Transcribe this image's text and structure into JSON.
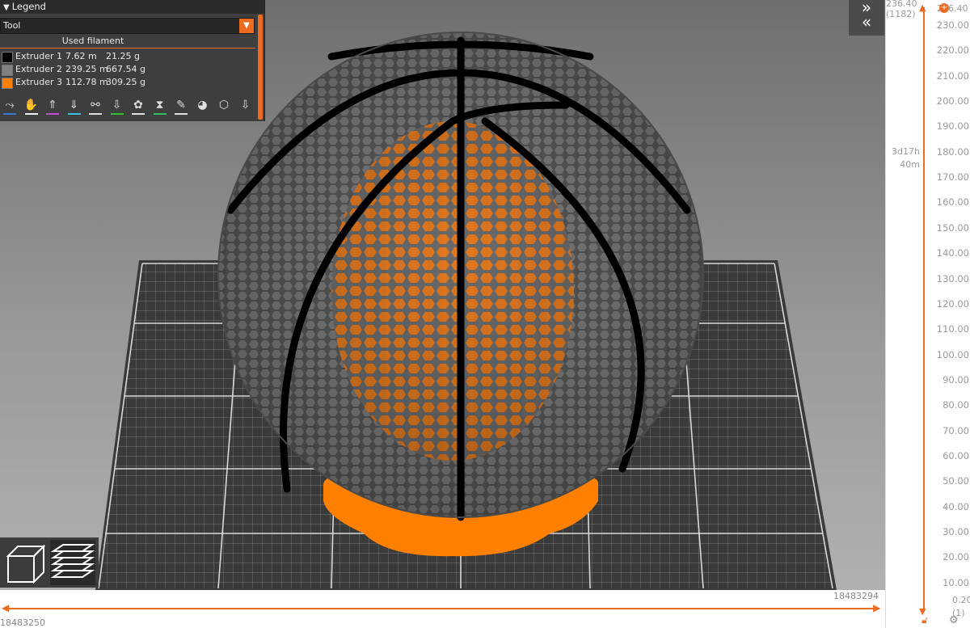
{
  "legend": {
    "title": "Legend",
    "view_type": "Tool",
    "used_filament_label": "Used filament",
    "extruders": [
      {
        "name": "Extruder 1",
        "length": "7.62 m",
        "weight": "21.25 g",
        "color": "#000000"
      },
      {
        "name": "Extruder 2",
        "length": "239.25 m",
        "weight": "667.54 g",
        "color": "#808080"
      },
      {
        "name": "Extruder 3",
        "length": "112.78 m",
        "weight": "309.25 g",
        "color": "#ff8000"
      }
    ],
    "tool_icons": [
      {
        "name": "travel-icon",
        "glyph": "⤳",
        "bar": "#3a7bd5"
      },
      {
        "name": "wipe-icon",
        "glyph": "✋",
        "bar": "#f0f0f0"
      },
      {
        "name": "retractions-icon",
        "glyph": "⇑",
        "bar": "#c04bd0"
      },
      {
        "name": "deretractions-icon",
        "glyph": "⇓",
        "bar": "#3ac0e0"
      },
      {
        "name": "seams-icon",
        "glyph": "⚯",
        "bar": "#e0e0e0"
      },
      {
        "name": "tool-changes-icon",
        "glyph": "⇩",
        "bar": "#30c030"
      },
      {
        "name": "color-changes-icon",
        "glyph": "✿",
        "bar": "#e0e0e0"
      },
      {
        "name": "pause-prints-icon",
        "glyph": "⧗",
        "bar": "#30c060"
      },
      {
        "name": "custom-gcodes-icon",
        "glyph": "✎",
        "bar": "#e0e0e0"
      },
      {
        "name": "center-of-gravity-icon",
        "glyph": "◕",
        "bar": ""
      },
      {
        "name": "shells-icon",
        "glyph": "⬡",
        "bar": ""
      },
      {
        "name": "tool-marker-icon",
        "glyph": "⇩",
        "bar": ""
      }
    ]
  },
  "vertical_slider": {
    "top_value": "236.40",
    "top_layer": "(1182)",
    "top_right_value": "236.40",
    "estimated_time_line1": "3d17h",
    "estimated_time_line2": "40m",
    "ticks": [
      "230.00",
      "220.00",
      "210.00",
      "200.00",
      "190.00",
      "180.00",
      "170.00",
      "160.00",
      "150.00",
      "140.00",
      "130.00",
      "120.00",
      "110.00",
      "100.00",
      "90.00",
      "80.00",
      "70.00",
      "60.00",
      "50.00",
      "40.00",
      "30.00",
      "20.00",
      "10.00"
    ],
    "bottom_value": "0.20",
    "bottom_layer": "(1)"
  },
  "horizontal_slider": {
    "left_value": "18483250",
    "right_value": "18483294"
  },
  "colors": {
    "accent": "#ed6b21",
    "model_gray": "#7a7a7a",
    "model_orange": "#ff8000",
    "seam_black": "#000000"
  }
}
